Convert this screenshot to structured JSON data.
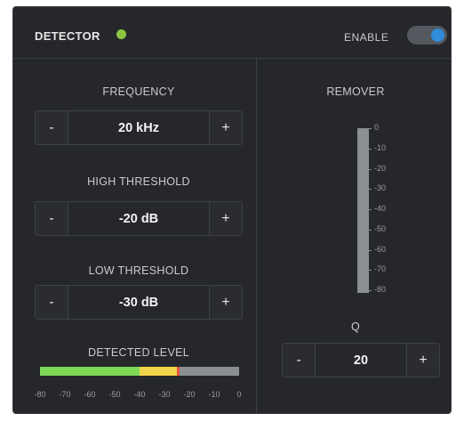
{
  "header": {
    "title": "DETECTOR",
    "status_color": "#8cc63f",
    "enable_label": "ENABLE",
    "enable_on": true
  },
  "frequency": {
    "label": "FREQUENCY",
    "value": "20 kHz",
    "minus": "-",
    "plus": "+"
  },
  "high_threshold": {
    "label": "HIGH THRESHOLD",
    "value": "-20 dB",
    "minus": "-",
    "plus": "+"
  },
  "low_threshold": {
    "label": "LOW THRESHOLD",
    "value": "-30 dB",
    "minus": "-",
    "plus": "+"
  },
  "detected_level": {
    "label": "DETECTED LEVEL",
    "ticks": [
      "-80",
      "-70",
      "-60",
      "-50",
      "-40",
      "-30",
      "-20",
      "-10",
      "0"
    ],
    "segments": [
      {
        "from_db": -80,
        "to_db": -40,
        "color": "#7ed957"
      },
      {
        "from_db": -40,
        "to_db": -25,
        "color": "#f0d54a"
      },
      {
        "from_db": -25,
        "to_db": -24,
        "color": "#e0533c"
      },
      {
        "from_db": -24,
        "to_db": 0,
        "color": "#8b8f94"
      }
    ]
  },
  "remover": {
    "label": "REMOVER",
    "ticks": [
      "0",
      "-10",
      "-20",
      "-30",
      "-40",
      "-50",
      "-60",
      "-70",
      "-80"
    ]
  },
  "q": {
    "label": "Q",
    "value": "20",
    "minus": "-",
    "plus": "+"
  }
}
